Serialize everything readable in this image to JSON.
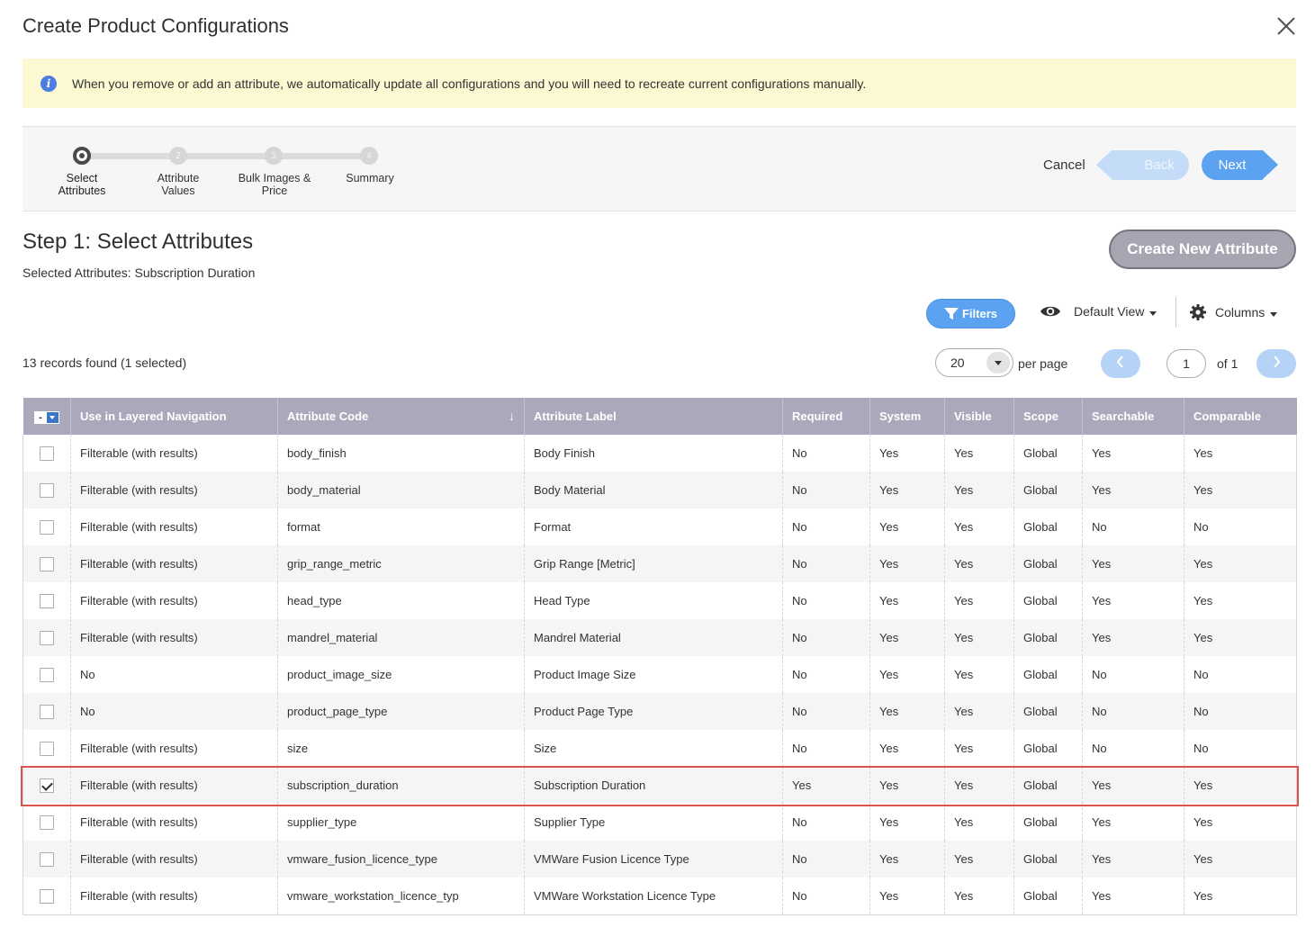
{
  "modal": {
    "title": "Create Product Configurations",
    "notice": "When you remove or add an attribute, we automatically update all configurations and you will need to recreate current configurations manually."
  },
  "wizard": {
    "steps": [
      {
        "number": "",
        "label_line1": "Select",
        "label_line2": "Attributes"
      },
      {
        "number": "2",
        "label_line1": "Attribute",
        "label_line2": "Values"
      },
      {
        "number": "3",
        "label_line1": "Bulk Images &",
        "label_line2": "Price"
      },
      {
        "number": "4",
        "label_line1": "Summary",
        "label_line2": ""
      }
    ],
    "cancel": "Cancel",
    "back": "Back",
    "next": "Next"
  },
  "step": {
    "title": "Step 1: Select Attributes",
    "selected": "Selected Attributes: Subscription Duration",
    "create_button": "Create New Attribute"
  },
  "toolbar": {
    "filters": "Filters",
    "view": "Default View",
    "columns": "Columns",
    "records": "13 records found (1 selected)",
    "per_page_value": "20",
    "per_page_label": "per page",
    "page_value": "1",
    "page_of": "of 1"
  },
  "grid": {
    "headers": [
      "Use in Layered Navigation",
      "Attribute Code",
      "Attribute Label",
      "Required",
      "System",
      "Visible",
      "Scope",
      "Searchable",
      "Comparable"
    ],
    "sorted_column": "Attribute Code",
    "rows": [
      {
        "checked": false,
        "cells": [
          "Filterable (with results)",
          "body_finish",
          "Body Finish",
          "No",
          "Yes",
          "Yes",
          "Global",
          "Yes",
          "Yes"
        ]
      },
      {
        "checked": false,
        "cells": [
          "Filterable (with results)",
          "body_material",
          "Body Material",
          "No",
          "Yes",
          "Yes",
          "Global",
          "Yes",
          "Yes"
        ]
      },
      {
        "checked": false,
        "cells": [
          "Filterable (with results)",
          "format",
          "Format",
          "No",
          "Yes",
          "Yes",
          "Global",
          "No",
          "No"
        ]
      },
      {
        "checked": false,
        "cells": [
          "Filterable (with results)",
          "grip_range_metric",
          "Grip Range [Metric]",
          "No",
          "Yes",
          "Yes",
          "Global",
          "Yes",
          "Yes"
        ]
      },
      {
        "checked": false,
        "cells": [
          "Filterable (with results)",
          "head_type",
          "Head Type",
          "No",
          "Yes",
          "Yes",
          "Global",
          "Yes",
          "Yes"
        ]
      },
      {
        "checked": false,
        "cells": [
          "Filterable (with results)",
          "mandrel_material",
          "Mandrel Material",
          "No",
          "Yes",
          "Yes",
          "Global",
          "Yes",
          "Yes"
        ]
      },
      {
        "checked": false,
        "cells": [
          "No",
          "product_image_size",
          "Product Image Size",
          "No",
          "Yes",
          "Yes",
          "Global",
          "No",
          "No"
        ]
      },
      {
        "checked": false,
        "cells": [
          "No",
          "product_page_type",
          "Product Page Type",
          "No",
          "Yes",
          "Yes",
          "Global",
          "No",
          "No"
        ]
      },
      {
        "checked": false,
        "cells": [
          "Filterable (with results)",
          "size",
          "Size",
          "No",
          "Yes",
          "Yes",
          "Global",
          "No",
          "No"
        ]
      },
      {
        "checked": true,
        "cells": [
          "Filterable (with results)",
          "subscription_duration",
          "Subscription Duration",
          "Yes",
          "Yes",
          "Yes",
          "Global",
          "Yes",
          "Yes"
        ]
      },
      {
        "checked": false,
        "cells": [
          "Filterable (with results)",
          "supplier_type",
          "Supplier Type",
          "No",
          "Yes",
          "Yes",
          "Global",
          "Yes",
          "Yes"
        ]
      },
      {
        "checked": false,
        "cells": [
          "Filterable (with results)",
          "vmware_fusion_licence_type",
          "VMWare Fusion Licence Type",
          "No",
          "Yes",
          "Yes",
          "Global",
          "Yes",
          "Yes"
        ]
      },
      {
        "checked": false,
        "cells": [
          "Filterable (with results)",
          "vmware_workstation_licence_typ",
          "VMWare Workstation Licence Type",
          "No",
          "Yes",
          "Yes",
          "Global",
          "Yes",
          "Yes"
        ]
      }
    ]
  },
  "colors": {
    "accent": "#5ba2f0",
    "notice_bg": "#fcf8d2",
    "header_bg": "#a9a9bb",
    "highlight": "#d9534f"
  }
}
